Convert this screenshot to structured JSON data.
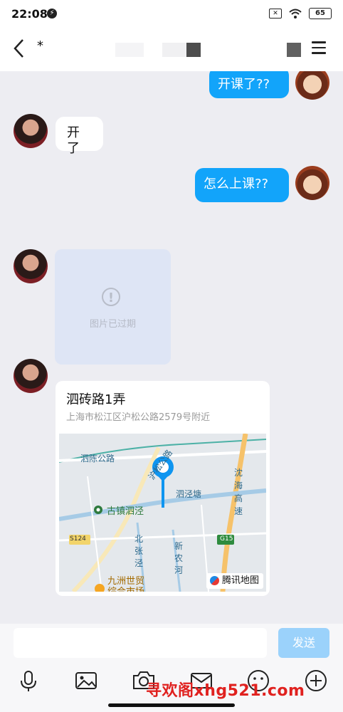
{
  "status": {
    "time": "22:08",
    "battery": "65"
  },
  "nav": {
    "contact_name": "*"
  },
  "messages": {
    "m1_sent": "开课了??",
    "m2_received": "开了",
    "m3_sent": "怎么上课??",
    "m4_expired_image": "图片已过期",
    "m5_location": {
      "title": "泗砖路1弄",
      "address": "上海市松江区沪松公路2579号附近",
      "map_labels": [
        "泗陈公路",
        "沪松公路",
        "沈海高速",
        "泗泾塘",
        "古镇泗泾",
        "北张泾",
        "新农河",
        "九洲世贸",
        "综合市场",
        "S124",
        "G15"
      ],
      "map_provider": "腾讯地图"
    }
  },
  "input": {
    "placeholder": "",
    "send_label": "发送"
  },
  "toolbar": {
    "icons": [
      "microphone-icon",
      "image-icon",
      "camera-icon",
      "envelope-icon",
      "emoji-icon",
      "plus-icon"
    ]
  },
  "watermark": "寻欢阁xhg521.com",
  "colors": {
    "sent_bubble": "#12a4fa",
    "send_button": "#9bd2fb",
    "background": "#ededf2"
  }
}
